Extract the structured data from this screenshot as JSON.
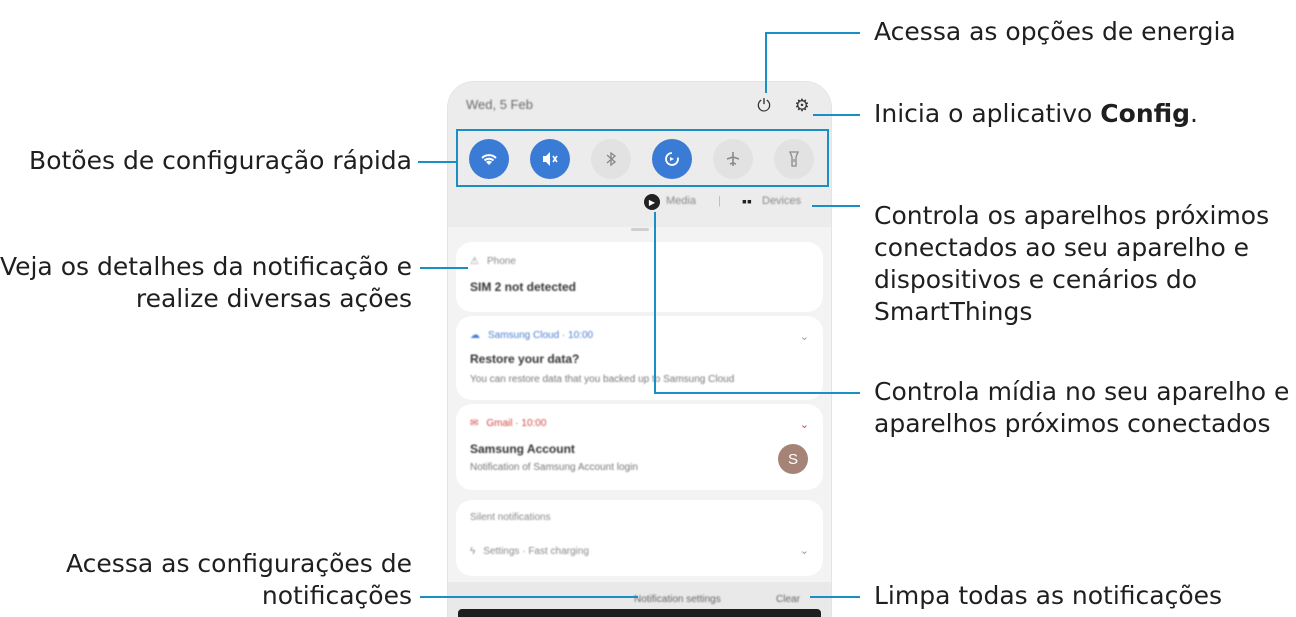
{
  "annotations": {
    "power": "Acessa as opções de energia",
    "config_prefix": "Inicia o aplicativo ",
    "config_bold": "Config",
    "config_suffix": ".",
    "quick_settings": "Botões de configuração rápida",
    "smartthings_l1": "Controla os aparelhos próximos",
    "smartthings_l2": "conectados ao seu aparelho e",
    "smartthings_l3": "dispositivos e cenários do",
    "smartthings_l4": "SmartThings",
    "notification_l1": "Veja os detalhes da notificação e",
    "notification_l2": "realize diversas ações",
    "media_l1": "Controla mídia no seu aparelho e",
    "media_l2": "aparelhos próximos conectados",
    "notif_settings_l1": "Acessa as configurações de",
    "notif_settings_l2": "notificações",
    "clear_all": "Limpa todas as notificações"
  },
  "panel": {
    "datetime": "Wed, 5 Feb",
    "icons": {
      "power": "power-icon",
      "settings": "gear-icon"
    },
    "quick_settings": [
      {
        "name": "wifi",
        "icon": "wifi-icon",
        "glyph": "◉",
        "active": true
      },
      {
        "name": "sound",
        "icon": "mute-icon",
        "glyph": "🔇",
        "active": true
      },
      {
        "name": "bluetooth",
        "icon": "bluetooth-icon",
        "glyph": "✱",
        "active": false
      },
      {
        "name": "auto-rotate",
        "icon": "rotate-icon",
        "glyph": "⟳",
        "active": true
      },
      {
        "name": "airplane",
        "icon": "airplane-icon",
        "glyph": "✈",
        "active": false
      },
      {
        "name": "flashlight",
        "icon": "flashlight-icon",
        "glyph": "♆",
        "active": false
      }
    ],
    "media_label": "Media",
    "devices_label": "Devices",
    "notifications": [
      {
        "app": "Phone",
        "title": "SIM 2 not detected",
        "body": ""
      },
      {
        "app": "Samsung Cloud · 10:00",
        "title": "Restore your data?",
        "body": "You can restore data that you backed up to Samsung Cloud"
      },
      {
        "app": "Gmail · 10:00",
        "title": "Samsung Account",
        "body": "Notification of Samsung Account login"
      }
    ],
    "silent_header": "Silent notifications",
    "silent_item": "Settings · Fast charging",
    "avatar_letter": "S",
    "notification_settings": "Notification settings",
    "clear": "Clear"
  },
  "colors": {
    "accent_leader": "#1a8fc4",
    "toggle_on": "#3a7bd5",
    "avatar": "#a58477"
  }
}
